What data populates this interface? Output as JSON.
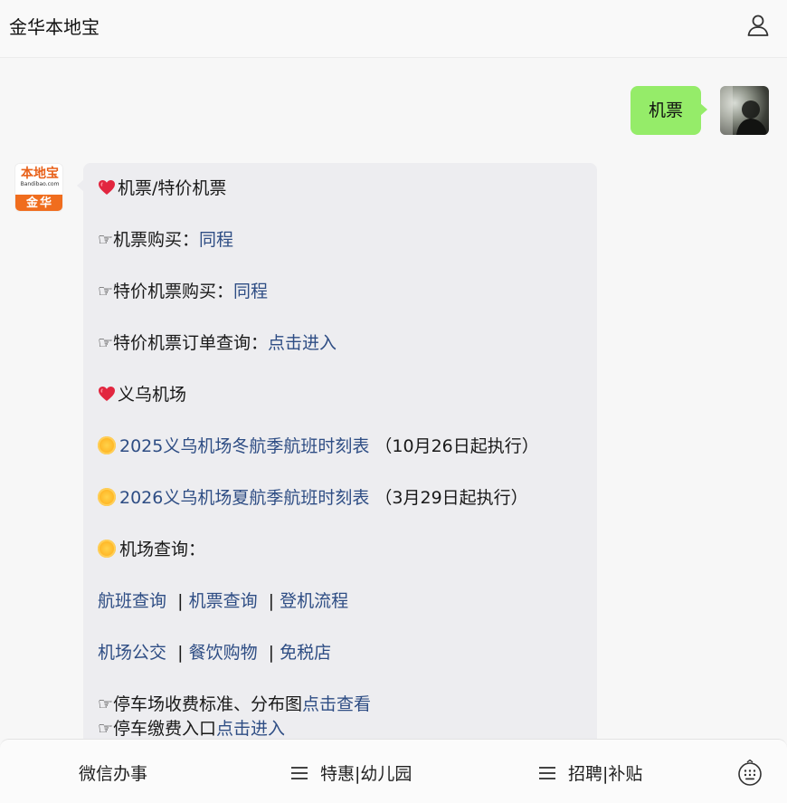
{
  "header": {
    "title": "金华本地宝",
    "user_icon": "user-icon"
  },
  "outgoing": {
    "text": "机票"
  },
  "bot": {
    "avatar": {
      "logo_text": "本地宝",
      "logo_domain": "Bandibao.com",
      "logo_city": "金华"
    }
  },
  "message": {
    "section1_title": "机票/特价机票",
    "row1_label": "☞机票购买：",
    "row1_link": "同程",
    "row2_label": "☞特价机票购买：",
    "row2_link": "同程",
    "row3_label": "☞特价机票订单查询：",
    "row3_link": "点击进入",
    "section2_title": "义乌机场",
    "schedule1_link": "2025义乌机场冬航季航班时刻表",
    "schedule1_note": "（10月26日起执行）",
    "schedule2_link": "2026义乌机场夏航季航班时刻表",
    "schedule2_note": "（3月29日起执行）",
    "query_title": "机场查询：",
    "links_row1": [
      "航班查询",
      "机票查询",
      "登机流程"
    ],
    "links_row2": [
      "机场公交",
      "餐饮购物",
      "免税店"
    ],
    "separator": "|",
    "parking1_label": "☞停车场收费标准、分布图",
    "parking1_link": "点击查看",
    "parking2_label": "☞停车缴费入口",
    "parking2_link": "点击进入"
  },
  "bottom_bar": {
    "item1": "微信办事",
    "item2": "特惠|幼儿园",
    "item3": "招聘|补贴",
    "keyboard_icon": "keyboard-icon"
  }
}
